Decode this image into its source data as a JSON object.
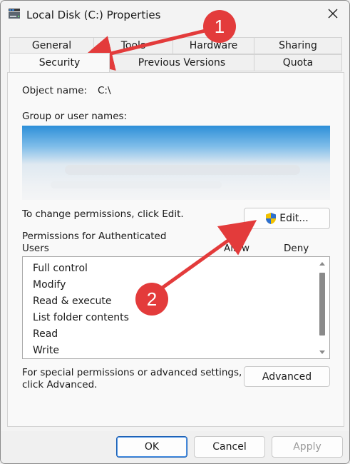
{
  "window": {
    "title": "Local Disk (C:) Properties",
    "icon": "drive-icon",
    "close_icon": "close-icon"
  },
  "tabs": {
    "row1": [
      {
        "label": "General"
      },
      {
        "label": "Tools"
      },
      {
        "label": "Hardware"
      },
      {
        "label": "Sharing"
      }
    ],
    "row2": [
      {
        "label": "Security",
        "active": true
      },
      {
        "label": "Previous Versions"
      },
      {
        "label": "Quota"
      }
    ]
  },
  "security": {
    "object_name_label": "Object name:",
    "object_name_value": "C:\\",
    "group_label": "Group or user names:",
    "change_permissions_text": "To change permissions, click Edit.",
    "edit_button": "Edit...",
    "edit_icon": "uac-shield-icon",
    "permissions_for_line1": "Permissions for Authenticated",
    "permissions_for_line2": "Users",
    "allow_header": "Allow",
    "deny_header": "Deny",
    "permissions": [
      {
        "label": "Full control"
      },
      {
        "label": "Modify"
      },
      {
        "label": "Read & execute"
      },
      {
        "label": "List folder contents"
      },
      {
        "label": "Read"
      },
      {
        "label": "Write"
      }
    ],
    "special_line1": "For special permissions or advanced settings,",
    "special_line2": "click Advanced.",
    "advanced_button": "Advanced"
  },
  "footer": {
    "ok": "OK",
    "cancel": "Cancel",
    "apply": "Apply"
  },
  "annotations": {
    "badge1": "1",
    "badge2": "2",
    "color": "#e33b3b"
  }
}
